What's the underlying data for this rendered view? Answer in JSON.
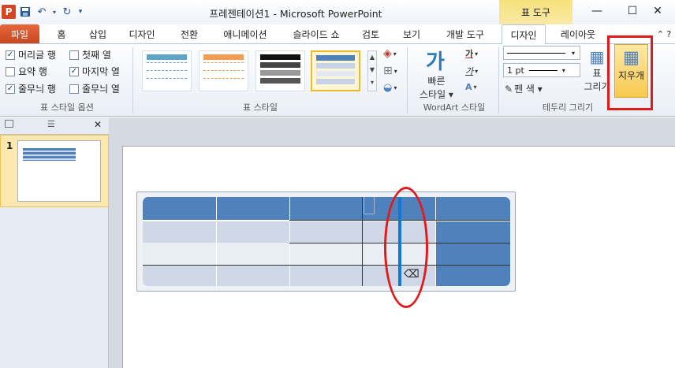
{
  "window": {
    "title": "프레젠테이션1 - Microsoft PowerPoint",
    "context_tab": "표 도구",
    "min": "—",
    "max": "☐",
    "close": "✕",
    "app_letter": "P"
  },
  "tabs": [
    "파일",
    "홈",
    "삽입",
    "디자인",
    "전환",
    "애니메이션",
    "슬라이드 쇼",
    "검토",
    "보기",
    "개발 도구",
    "디자인",
    "레이아웃"
  ],
  "help": "⌃ ?",
  "style_options": {
    "items": [
      {
        "label": "머리글 행",
        "checked": true
      },
      {
        "label": "첫째 열",
        "checked": false
      },
      {
        "label": "요약 행",
        "checked": false
      },
      {
        "label": "마지막 열",
        "checked": true
      },
      {
        "label": "줄무늬 행",
        "checked": true
      },
      {
        "label": "줄무늬 열",
        "checked": false
      }
    ],
    "group_label": "표 스타일 옵션"
  },
  "table_styles": {
    "group_label": "표 스타일"
  },
  "wordart": {
    "quick_styles_1": "빠른",
    "quick_styles_2": "스타일 ▾",
    "group_label": "WordArt 스타일",
    "ga": "가",
    "ga_fill": "가"
  },
  "borders": {
    "pen_weight": "1 pt",
    "pen_color": "펜 색 ▾",
    "draw_1": "표",
    "draw_2": "그리기",
    "eraser": "지우개",
    "group_label": "테두리 그리기"
  },
  "slide_panel": {
    "slide_number": "1",
    "close": "✕"
  },
  "colors": {
    "accent": "#4f81bd",
    "header": "#4f81bd",
    "band_dark": "#d0d8e8",
    "band_light": "#e9edf4",
    "highlight_line": "#1278d6",
    "annotation": "#e01b1b"
  }
}
